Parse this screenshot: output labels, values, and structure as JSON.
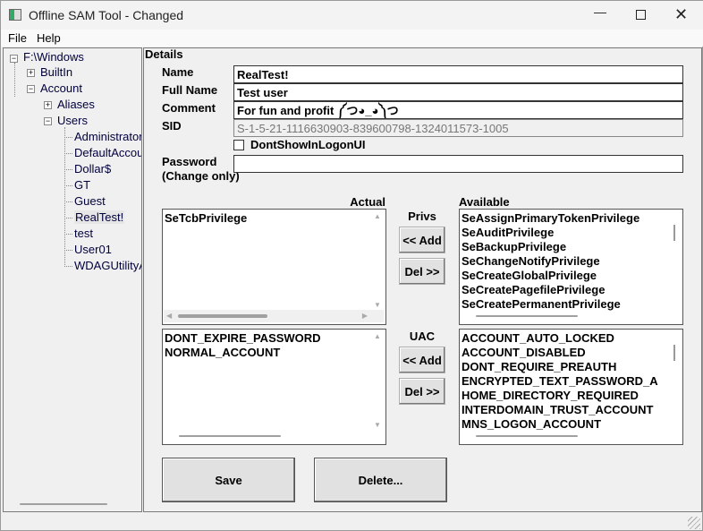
{
  "window": {
    "title": "Offline SAM Tool - Changed",
    "icon": "app-icon",
    "controls": [
      "minimize-icon",
      "maximize-icon",
      "close-icon"
    ]
  },
  "menu": [
    "File",
    "Help"
  ],
  "tree": {
    "root": "F:\\Windows",
    "builtin": "BuiltIn",
    "account": "Account",
    "aliases": "Aliases",
    "users": "Users",
    "user_items": [
      "Administrator",
      "DefaultAccount",
      "Dollar$",
      "GT",
      "Guest",
      "RealTest!",
      "test",
      "User01",
      "WDAGUtilityAccount"
    ],
    "selected": "RealTest!"
  },
  "details": {
    "heading": "Details",
    "name_label": "Name",
    "name": "RealTest!",
    "fullname_label": "Full Name",
    "fullname": "Test user",
    "comment_label": "Comment",
    "comment": "For fun and profit ༼つ◕_◕༽つ",
    "sid_label": "SID",
    "sid": "S-1-5-21-1116630903-839600798-1324011573-1005",
    "dontshow_label": "DontShowInLogonUI",
    "dontshow_checked": false,
    "password_label": "Password",
    "password_note": "(Change only)",
    "password": ""
  },
  "lists": {
    "actual_label": "Actual",
    "available_label": "Available",
    "privs_label": "Privs",
    "uac_label": "UAC",
    "add_label": "<< Add",
    "del_label": "Del >>",
    "privs_actual": [
      "SeTcbPrivilege"
    ],
    "privs_available": [
      "SeAssignPrimaryTokenPrivilege",
      "SeAuditPrivilege",
      "SeBackupPrivilege",
      "SeChangeNotifyPrivilege",
      "SeCreateGlobalPrivilege",
      "SeCreatePagefilePrivilege",
      "SeCreatePermanentPrivilege"
    ],
    "uac_actual": [
      "DONT_EXPIRE_PASSWORD",
      "NORMAL_ACCOUNT"
    ],
    "uac_available": [
      "ACCOUNT_AUTO_LOCKED",
      "ACCOUNT_DISABLED",
      "DONT_REQUIRE_PREAUTH",
      "ENCRYPTED_TEXT_PASSWORD_A",
      "HOME_DIRECTORY_REQUIRED",
      "INTERDOMAIN_TRUST_ACCOUNT",
      "MNS_LOGON_ACCOUNT"
    ]
  },
  "actions": {
    "save": "Save",
    "delete": "Delete..."
  }
}
